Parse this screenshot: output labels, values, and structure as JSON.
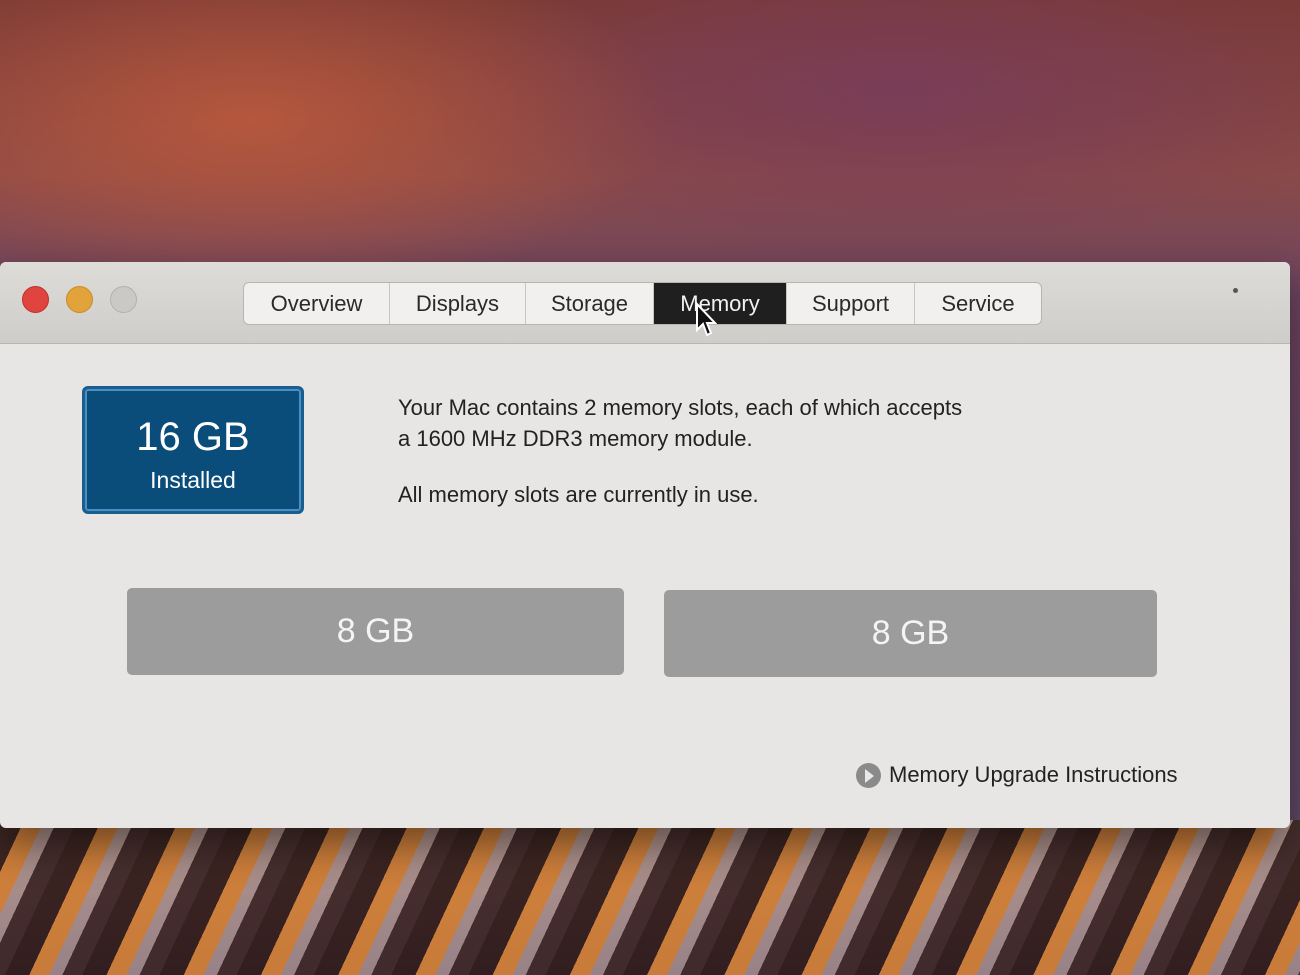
{
  "tabs": [
    {
      "label": "Overview"
    },
    {
      "label": "Displays"
    },
    {
      "label": "Storage"
    },
    {
      "label": "Memory"
    },
    {
      "label": "Support"
    },
    {
      "label": "Service"
    }
  ],
  "active_tab": "Memory",
  "badge": {
    "size": "16 GB",
    "label": "Installed"
  },
  "description": {
    "line1": "Your Mac contains 2 memory slots, each of which accepts",
    "line2": "a 1600 MHz DDR3 memory module.",
    "status": "All memory slots are currently in use."
  },
  "slots": [
    {
      "label": "8 GB"
    },
    {
      "label": "8 GB"
    }
  ],
  "upgrade_link": {
    "label": "Memory Upgrade Instructions",
    "icon": "arrow-circle-icon"
  },
  "colors": {
    "badge": "#0a4c7a",
    "active_tab": "#1f1f1f",
    "slot": "#9c9c9c",
    "close": "#e0443e",
    "minimize": "#e2a43a"
  }
}
